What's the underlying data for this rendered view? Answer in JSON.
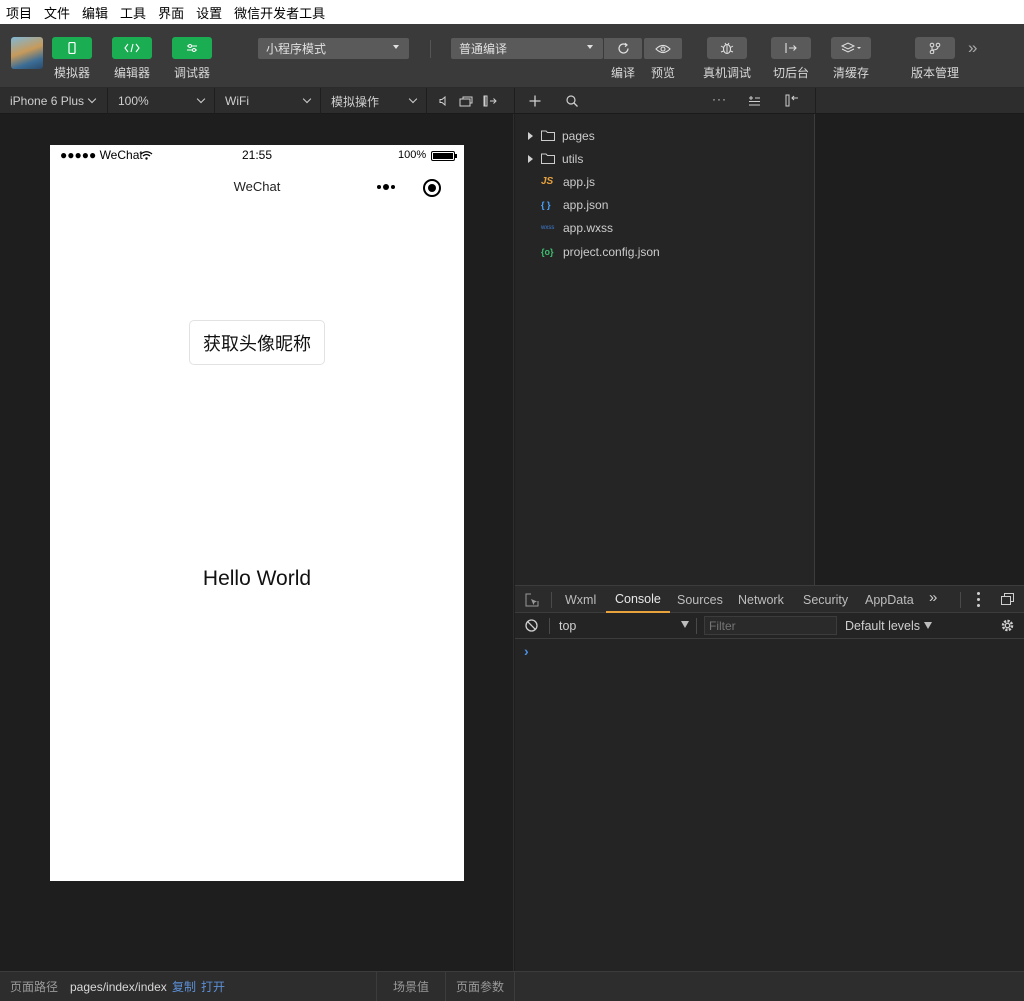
{
  "menubar": [
    "项目",
    "文件",
    "编辑",
    "工具",
    "界面",
    "设置",
    "微信开发者工具"
  ],
  "toolbar": {
    "simulator": "模拟器",
    "editor": "编辑器",
    "debugger": "调试器",
    "mode": "小程序模式",
    "compile_mode": "普通编译",
    "compile": "编译",
    "preview": "预览",
    "real_debug": "真机调试",
    "background": "切后台",
    "clear_cache": "清缓存",
    "version": "版本管理"
  },
  "subbar": {
    "device": "iPhone 6 Plus",
    "zoom": "100%",
    "network": "WiFi",
    "simulate": "模拟操作"
  },
  "phone": {
    "carrier": "●●●●● WeChat",
    "time": "21:55",
    "battery": "100%",
    "title": "WeChat",
    "button": "获取头像昵称",
    "hello": "Hello World"
  },
  "explorer": {
    "items": [
      {
        "type": "folder",
        "name": "pages",
        "icon": "folder-icon"
      },
      {
        "type": "folder",
        "name": "utils",
        "icon": "folder-icon"
      },
      {
        "type": "file",
        "name": "app.js",
        "badge": "JS",
        "badge_color": "#e8a33d"
      },
      {
        "type": "file",
        "name": "app.json",
        "badge": "{ }",
        "badge_color": "#4aa3ff"
      },
      {
        "type": "file",
        "name": "app.wxss",
        "badge": "wxss",
        "badge_color": "#3f7fd6"
      },
      {
        "type": "file",
        "name": "project.config.json",
        "badge": "{o}",
        "badge_color": "#3fbf6f"
      }
    ]
  },
  "devtools": {
    "tabs": [
      "Wxml",
      "Console",
      "Sources",
      "Network",
      "Security",
      "AppData"
    ],
    "active_tab": "Console",
    "context": "top",
    "filter_placeholder": "Filter",
    "levels": "Default levels",
    "prompt": "›"
  },
  "footer": {
    "path_label": "页面路径",
    "path": "pages/index/index",
    "copy": "复制",
    "open": "打开",
    "scene": "场景值",
    "params": "页面参数"
  },
  "colors": {
    "accent_green": "#1aad52",
    "console_active": "#e8a33d",
    "link_blue": "#5b8fd6"
  }
}
